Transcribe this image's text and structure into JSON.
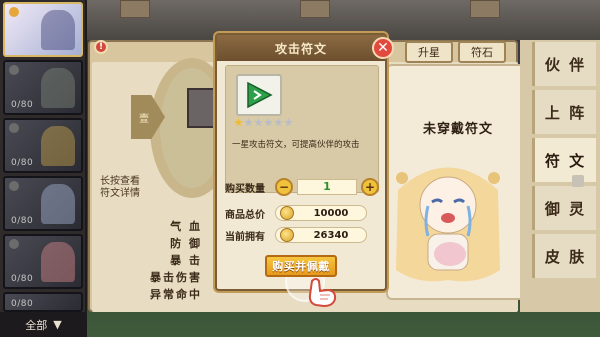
{
  "roster": {
    "slots": [
      {
        "count": "",
        "active": true
      },
      {
        "count": "0/80"
      },
      {
        "count": "0/80"
      },
      {
        "count": "0/80"
      },
      {
        "count": "0/80"
      },
      {
        "count": "0/80"
      }
    ],
    "filter_label": "全部",
    "filter_icon": "triangle-down-icon"
  },
  "top": {
    "upgrade_label": "升星",
    "rune_stone_label": "符石"
  },
  "panel": {
    "hint_line1": "长按查看",
    "hint_line2": "符文详情",
    "stats": [
      "气 血",
      "防 御",
      "暴 击",
      "暴击伤害",
      "异常命中"
    ],
    "level_tag": "壹",
    "empty_slot_title": "未穿戴符文"
  },
  "tabs": [
    "伙 伴",
    "上 阵",
    "符 文",
    "御 灵",
    "皮 肤"
  ],
  "active_tab": 2,
  "modal": {
    "title": "攻击符文",
    "close_icon": "close-icon",
    "rune_icon": "attack-rune-icon",
    "rune_stars": 1,
    "rune_max_stars": 6,
    "description": "一星攻击符文，可提高伙伴的攻击",
    "qty_label": "购买数量",
    "qty_value": "1",
    "total_label": "商品总价",
    "total_value": "10000",
    "owned_label": "当前拥有",
    "owned_value": "26340",
    "buy_label": "购买并佩戴"
  },
  "colors": {
    "accent_gold": "#f1b92e",
    "close_red": "#e14a3d",
    "qty_green": "#2d8f2d"
  }
}
